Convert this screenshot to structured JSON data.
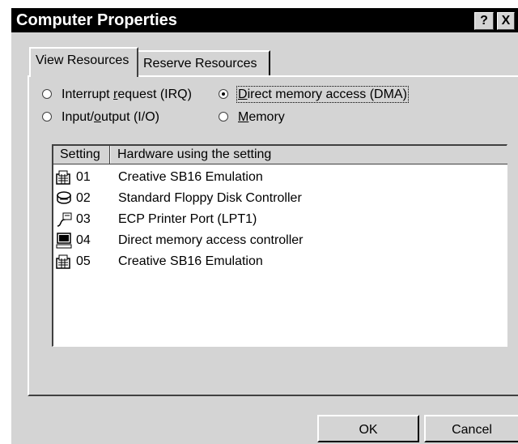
{
  "window": {
    "title": "Computer Properties",
    "help_label": "?",
    "close_label": "X"
  },
  "tabs": [
    {
      "label": "View Resources",
      "active": true
    },
    {
      "label": "Reserve Resources",
      "active": false
    }
  ],
  "radios": [
    {
      "pre": "Interrupt ",
      "accel": "r",
      "post": "equest (IRQ)",
      "checked": false
    },
    {
      "pre": "",
      "accel": "D",
      "post": "irect memory access (DMA)",
      "checked": true
    },
    {
      "pre": "Input/",
      "accel": "o",
      "post": "utput (I/O)",
      "checked": false
    },
    {
      "pre": "",
      "accel": "M",
      "post": "emory",
      "checked": false
    }
  ],
  "list": {
    "columns": [
      "Setting",
      "Hardware using the setting"
    ],
    "rows": [
      {
        "icon": "multimedia-icon",
        "setting": "01",
        "hardware": "Creative SB16 Emulation"
      },
      {
        "icon": "floppy-drive-icon",
        "setting": "02",
        "hardware": "Standard Floppy Disk Controller"
      },
      {
        "icon": "printer-port-icon",
        "setting": "03",
        "hardware": "ECP Printer Port (LPT1)"
      },
      {
        "icon": "computer-icon",
        "setting": "04",
        "hardware": "Direct memory access controller"
      },
      {
        "icon": "multimedia-icon",
        "setting": "05",
        "hardware": "Creative SB16 Emulation"
      }
    ]
  },
  "buttons": {
    "ok": "OK",
    "cancel": "Cancel"
  }
}
